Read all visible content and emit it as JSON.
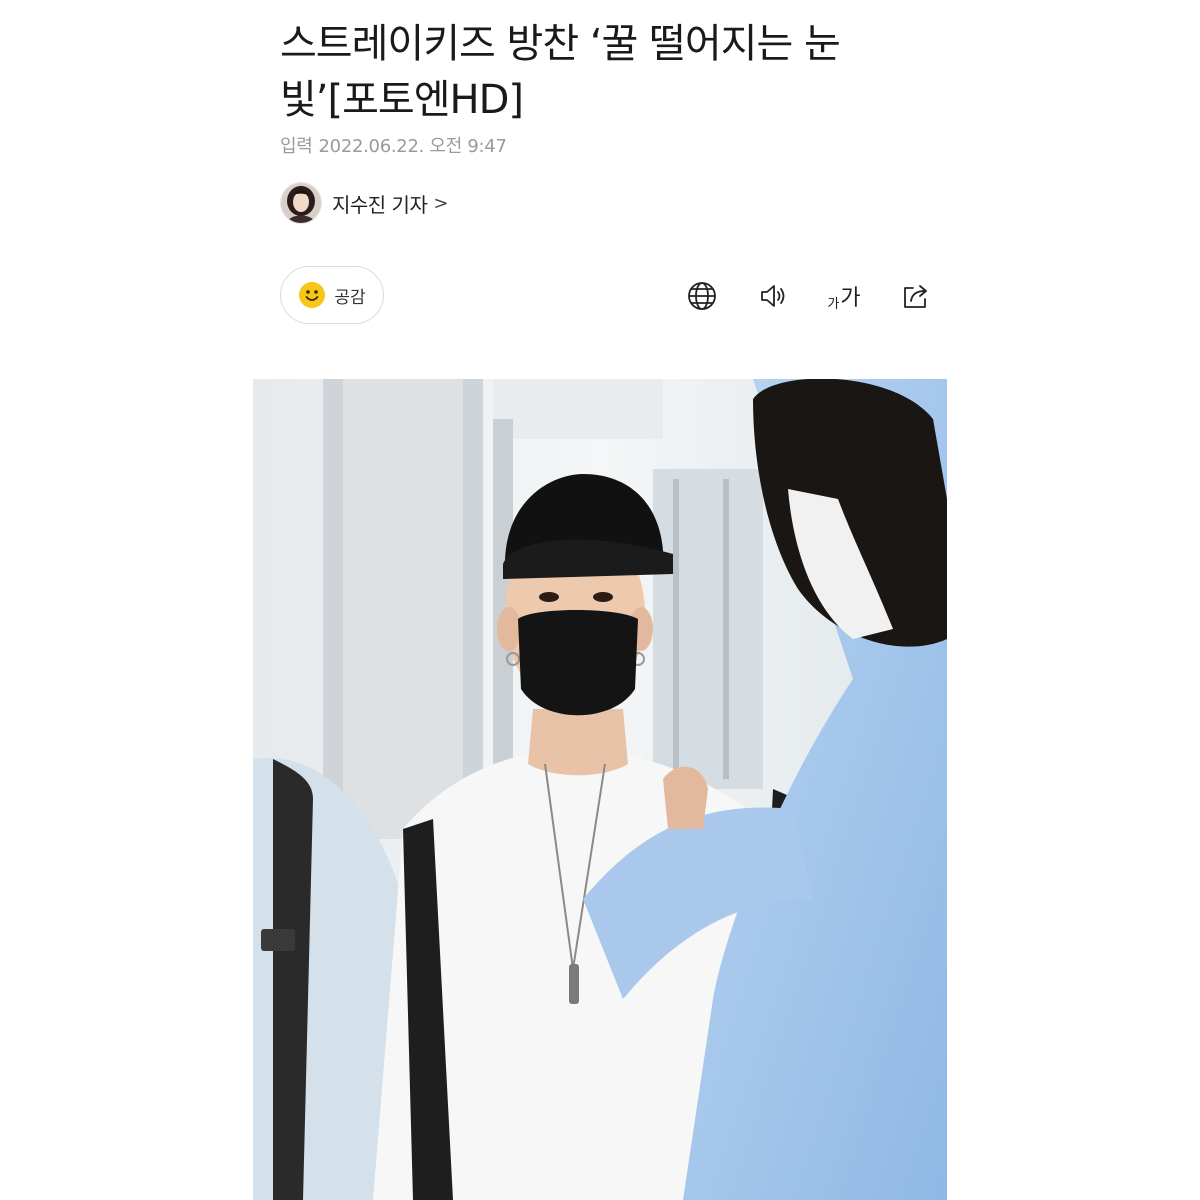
{
  "article": {
    "headline_line1": "스트레이키즈 방찬 ‘꿀 떨어지는 눈",
    "headline_line2": "빛’[포토엔HD]",
    "date_label": "입력",
    "date_value": "2022.06.22. 오전 9:47",
    "reporter_name": "지수진 기자",
    "reporter_chevron": ">"
  },
  "toolbar": {
    "empathy_label": "공감",
    "font_size_small": "가",
    "font_size_large": "가"
  },
  "icons": {
    "empathy": "smile-icon",
    "translate": "globe-icon",
    "listen": "speaker-icon",
    "font_size": "font-size-icon",
    "share": "share-icon"
  },
  "colors": {
    "text": "#1a1a1a",
    "meta": "#9a9a9a",
    "emoji": "#f7c619"
  }
}
